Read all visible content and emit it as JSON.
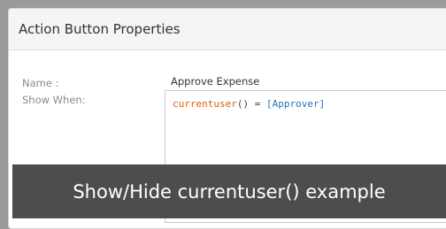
{
  "panel": {
    "title": "Action Button Properties"
  },
  "fields": {
    "name_label": "Name :",
    "name_value": "Approve Expense",
    "show_when_label": "Show When:"
  },
  "expression": {
    "fn": "currentuser",
    "parens": "()",
    "operator": " = ",
    "value": "[Approver]"
  },
  "caption": {
    "text": "Show/Hide currentuser() example"
  },
  "colors": {
    "function": "#c8641e",
    "value": "#2e6fb8",
    "caption_bg": "#4d4d4d"
  }
}
